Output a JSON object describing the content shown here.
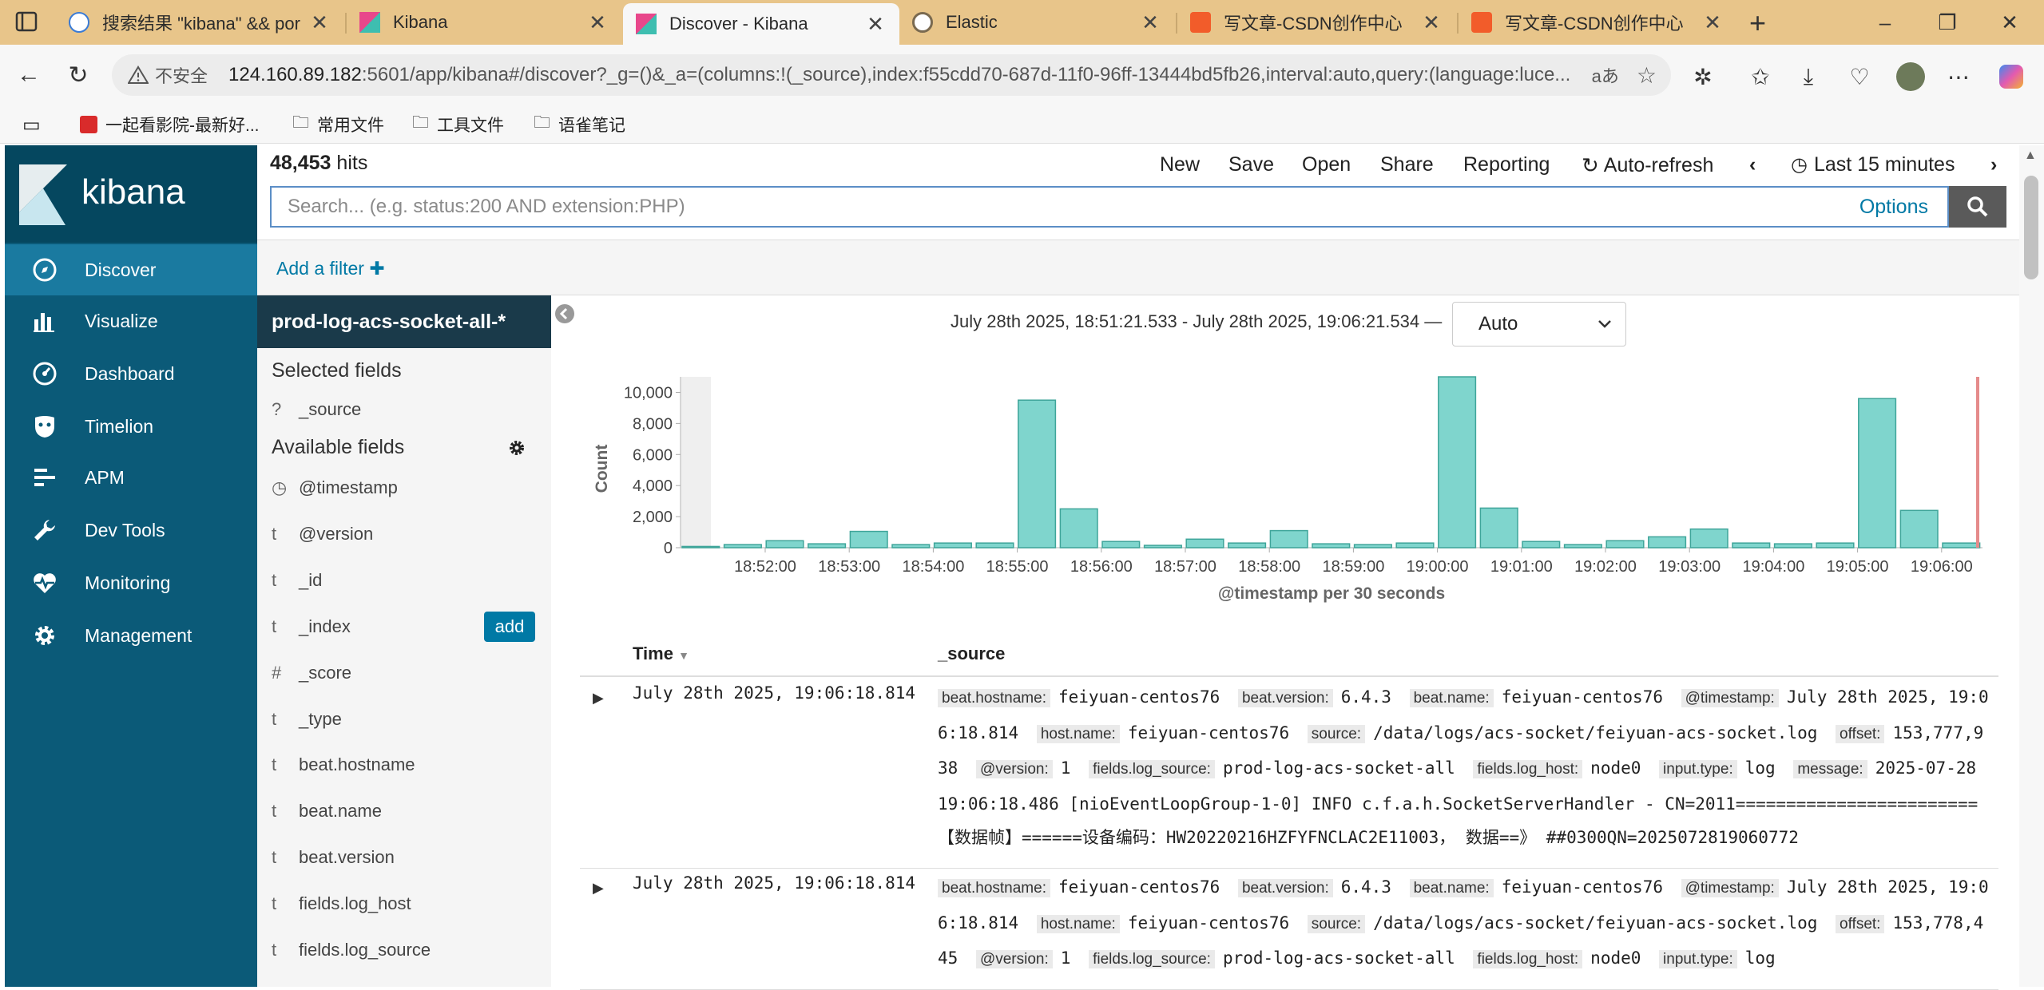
{
  "browser": {
    "tabs": [
      {
        "title": "搜索结果 \"kibana\" && por",
        "active": false
      },
      {
        "title": "Kibana",
        "active": false
      },
      {
        "title": "Discover - Kibana",
        "active": true
      },
      {
        "title": "Elastic",
        "active": false
      },
      {
        "title": "写文章-CSDN创作中心",
        "active": false
      },
      {
        "title": "写文章-CSDN创作中心",
        "active": false
      }
    ],
    "security_label": "不安全",
    "url_host": "124.160.89.182",
    "url_rest": ":5601/app/kibana#/discover?_g=()&_a=(columns:!(_source),index:f55cdd70-687d-11f0-96ff-13444bd5fb26,interval:auto,query:(language:luce...",
    "read_aloud": "aあ",
    "bookmarks": [
      "一起看影院-最新好...",
      "常用文件",
      "工具文件",
      "语雀笔记"
    ]
  },
  "kibana": {
    "logo_text": "kibana",
    "nav": [
      {
        "label": "Discover",
        "icon": "compass-icon",
        "active": true
      },
      {
        "label": "Visualize",
        "icon": "bar-chart-icon",
        "active": false
      },
      {
        "label": "Dashboard",
        "icon": "dashboard-gauge-icon",
        "active": false
      },
      {
        "label": "Timelion",
        "icon": "timelion-mask-icon",
        "active": false
      },
      {
        "label": "APM",
        "icon": "apm-list-icon",
        "active": false
      },
      {
        "label": "Dev Tools",
        "icon": "wrench-icon",
        "active": false
      },
      {
        "label": "Monitoring",
        "icon": "heartbeat-icon",
        "active": false
      },
      {
        "label": "Management",
        "icon": "gear-icon",
        "active": false
      }
    ],
    "hits_count": "48,453",
    "hits_label": "hits",
    "menu": {
      "new": "New",
      "save": "Save",
      "open": "Open",
      "share": "Share",
      "reporting": "Reporting",
      "autorefresh": "Auto-refresh",
      "timerange": "Last 15 minutes"
    },
    "search": {
      "placeholder": "Search... (e.g. status:200 AND extension:PHP)",
      "options": "Options"
    },
    "add_filter": "Add a filter",
    "index_pattern": "prod-log-acs-socket-all-*",
    "selected_fields_title": "Selected fields",
    "selected_fields": [
      {
        "type": "?",
        "name": "_source"
      }
    ],
    "available_fields_title": "Available fields",
    "available_fields": [
      {
        "type": "clock",
        "name": "@timestamp"
      },
      {
        "type": "t",
        "name": "@version"
      },
      {
        "type": "t",
        "name": "_id"
      },
      {
        "type": "t",
        "name": "_index"
      },
      {
        "type": "#",
        "name": "_score"
      },
      {
        "type": "t",
        "name": "_type"
      },
      {
        "type": "t",
        "name": "beat.hostname"
      },
      {
        "type": "t",
        "name": "beat.name"
      },
      {
        "type": "t",
        "name": "beat.version"
      },
      {
        "type": "t",
        "name": "fields.log_host"
      },
      {
        "type": "t",
        "name": "fields.log_source"
      }
    ],
    "add_button": "add",
    "date_range": "July 28th 2025, 18:51:21.533 - July 28th 2025, 19:06:21.534 —",
    "interval": "Auto"
  },
  "chart_data": {
    "type": "bar",
    "xlabel": "@timestamp per 30 seconds",
    "ylabel": "Count",
    "ylim": [
      0,
      11000
    ],
    "yticks": [
      0,
      2000,
      4000,
      6000,
      8000,
      10000
    ],
    "ytick_labels": [
      "0",
      "2,000",
      "4,000",
      "6,000",
      "8,000",
      "10,000"
    ],
    "xtick_labels": [
      "18:52:00",
      "18:53:00",
      "18:54:00",
      "18:55:00",
      "18:56:00",
      "18:57:00",
      "18:58:00",
      "18:59:00",
      "19:00:00",
      "19:01:00",
      "19:02:00",
      "19:03:00",
      "19:04:00",
      "19:05:00",
      "19:06:00"
    ],
    "bar_color": "#7fd5cd",
    "values": [
      80,
      200,
      450,
      250,
      1050,
      200,
      300,
      300,
      9500,
      2500,
      400,
      150,
      550,
      300,
      1100,
      250,
      200,
      300,
      11000,
      2550,
      400,
      200,
      450,
      700,
      1200,
      300,
      250,
      300,
      9600,
      2400,
      300
    ]
  },
  "table": {
    "col_time": "Time",
    "col_source": "_source",
    "rows": [
      {
        "time": "July 28th 2025, 19:06:18.814",
        "fields": [
          {
            "k": "beat.hostname:",
            "v": "feiyuan-centos76"
          },
          {
            "k": "beat.version:",
            "v": "6.4.3"
          },
          {
            "k": "beat.name:",
            "v": "feiyuan-centos76"
          },
          {
            "k": "@timestamp:",
            "v": "July 28th 2025, 19:06:18.814"
          },
          {
            "k": "host.name:",
            "v": "feiyuan-centos76"
          },
          {
            "k": "source:",
            "v": "/data/logs/acs-socket/feiyuan-acs-socket.log"
          },
          {
            "k": "offset:",
            "v": "153,777,938"
          },
          {
            "k": "@version:",
            "v": "1"
          },
          {
            "k": "fields.log_source:",
            "v": "prod-log-acs-socket-all"
          },
          {
            "k": "fields.log_host:",
            "v": "node0"
          },
          {
            "k": "input.type:",
            "v": "log"
          },
          {
            "k": "message:",
            "v": "2025-07-28 19:06:18.486 [nioEventLoopGroup-1-0] INFO c.f.a.h.SocketServerHandler - CN=2011========================【数据帧】======设备编码：HW20220216HZFYFNCLAC2E11003， 数据==》 ##0300QN=2025072819060772"
          }
        ]
      },
      {
        "time": "July 28th 2025, 19:06:18.814",
        "fields": [
          {
            "k": "beat.hostname:",
            "v": "feiyuan-centos76"
          },
          {
            "k": "beat.version:",
            "v": "6.4.3"
          },
          {
            "k": "beat.name:",
            "v": "feiyuan-centos76"
          },
          {
            "k": "@timestamp:",
            "v": "July 28th 2025, 19:06:18.814"
          },
          {
            "k": "host.name:",
            "v": "feiyuan-centos76"
          },
          {
            "k": "source:",
            "v": "/data/logs/acs-socket/feiyuan-acs-socket.log"
          },
          {
            "k": "offset:",
            "v": "153,778,445"
          },
          {
            "k": "@version:",
            "v": "1"
          },
          {
            "k": "fields.log_source:",
            "v": "prod-log-acs-socket-all"
          },
          {
            "k": "fields.log_host:",
            "v": "node0"
          },
          {
            "k": "input.type:",
            "v": "log"
          }
        ]
      }
    ]
  }
}
